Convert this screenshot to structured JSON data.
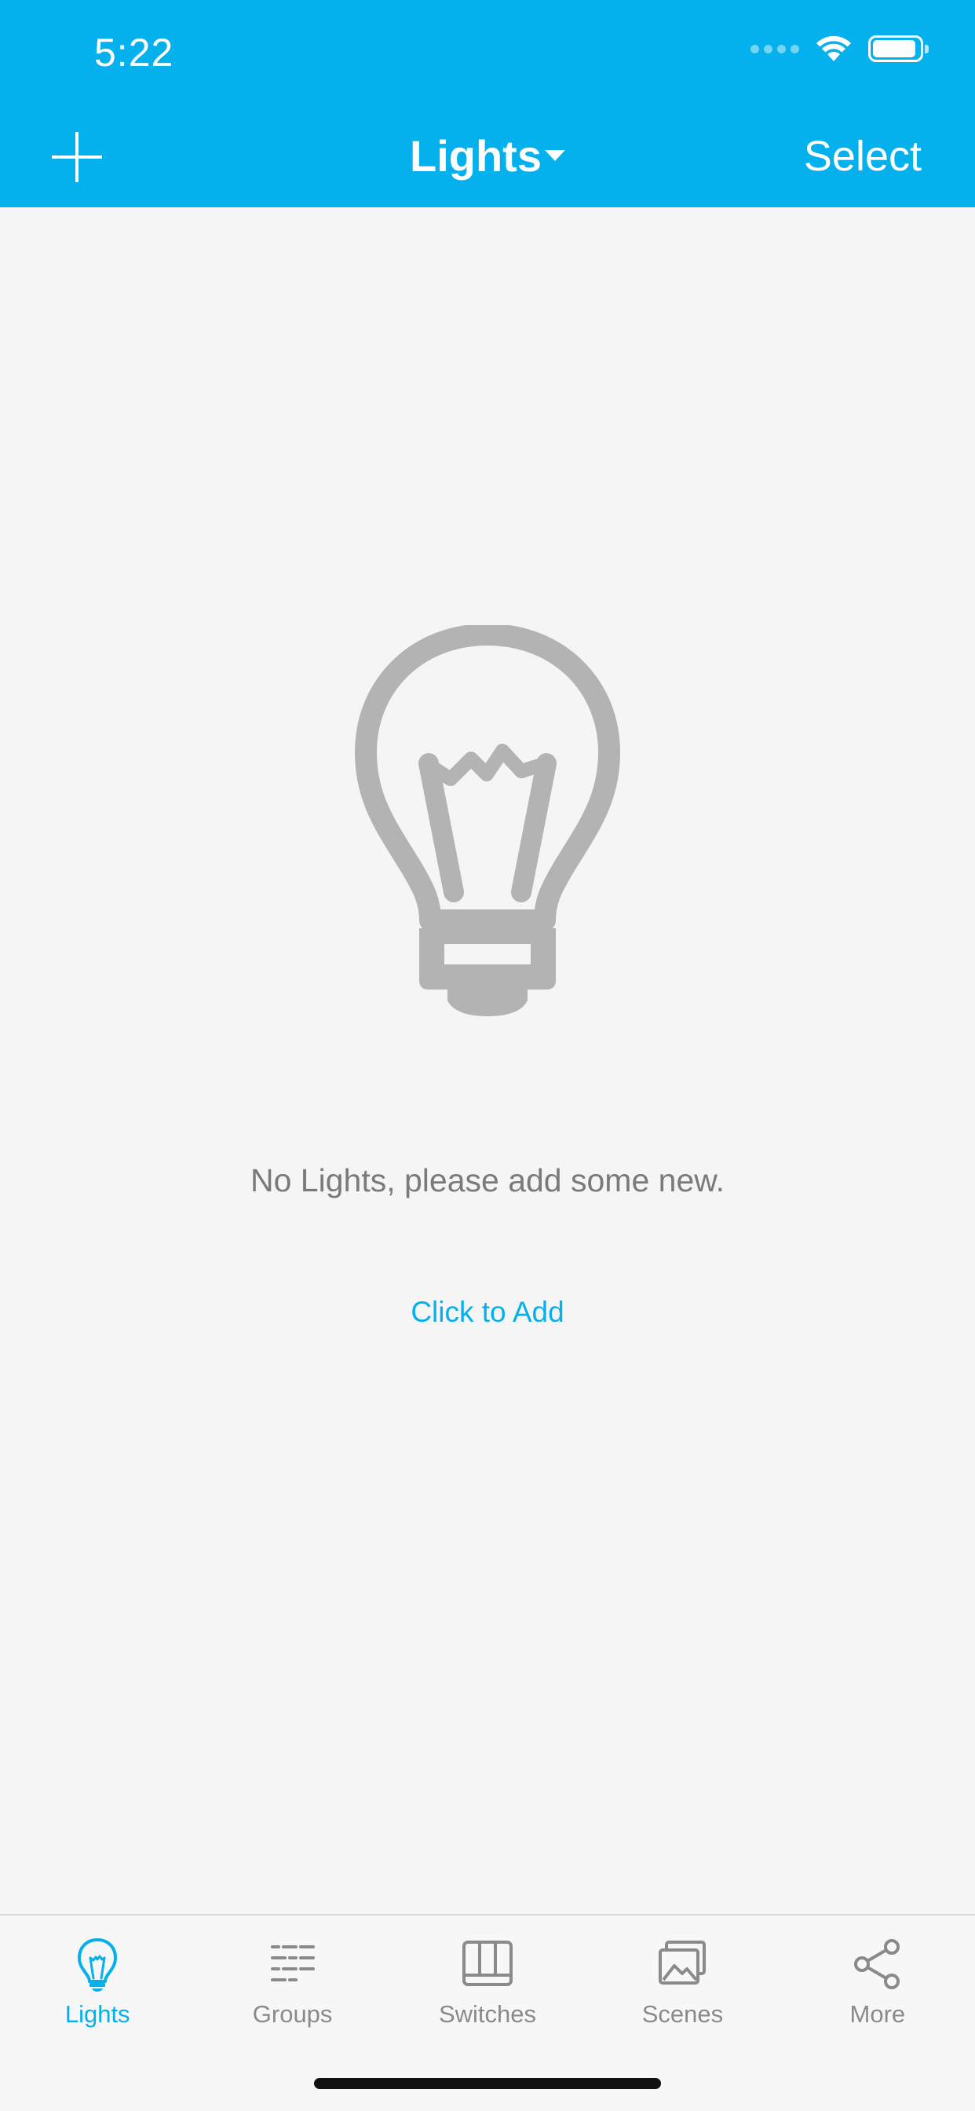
{
  "status_bar": {
    "time": "5:22",
    "battery_level": 0.92
  },
  "header": {
    "add_icon": "plus-icon",
    "title": "Lights",
    "title_caret_icon": "caret-down-icon",
    "select_label": "Select"
  },
  "empty_state": {
    "icon": "lightbulb-icon",
    "message": "No Lights, please add some new.",
    "action_label": "Click to Add"
  },
  "tabs": [
    {
      "label": "Lights",
      "icon": "lightbulb-icon",
      "active": true
    },
    {
      "label": "Groups",
      "icon": "groups-list-icon",
      "active": false
    },
    {
      "label": "Switches",
      "icon": "switch-icon",
      "active": false
    },
    {
      "label": "Scenes",
      "icon": "scenes-image-icon",
      "active": false
    },
    {
      "label": "More",
      "icon": "share-nodes-icon",
      "active": false
    }
  ],
  "colors": {
    "accent": "#04b1ec",
    "inactive": "#8a8a8a",
    "background": "#f5f5f5",
    "bulb_gray": "#b3b3b3"
  }
}
